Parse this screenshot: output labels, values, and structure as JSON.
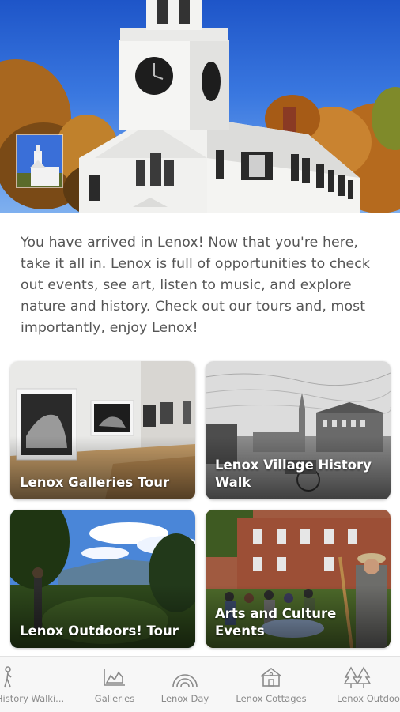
{
  "intro": {
    "text": "You have arrived in Lenox! Now that you're here, take it all in. Lenox is full of opportunities to check out events, see art, listen to music, and explore nature and history. Check out our tours and, most importantly, enjoy Lenox!"
  },
  "tours": [
    {
      "title": "Lenox Galleries Tour"
    },
    {
      "title": "Lenox Village History Walk"
    },
    {
      "title": "Lenox Outdoors! Tour"
    },
    {
      "title": "Arts and Culture Events"
    }
  ],
  "nav": {
    "items": [
      {
        "label": "History Walki...",
        "icon": "hiker-icon"
      },
      {
        "label": "Galleries",
        "icon": "chart-icon"
      },
      {
        "label": "Lenox Day",
        "icon": "rainbow-icon"
      },
      {
        "label": "Lenox Cottages",
        "icon": "house-icon"
      },
      {
        "label": "Lenox Outdoo",
        "icon": "trees-icon"
      }
    ]
  },
  "colors": {
    "text": "#555555",
    "nav_text": "#8a8a8a",
    "nav_bg": "#f7f7f7"
  }
}
